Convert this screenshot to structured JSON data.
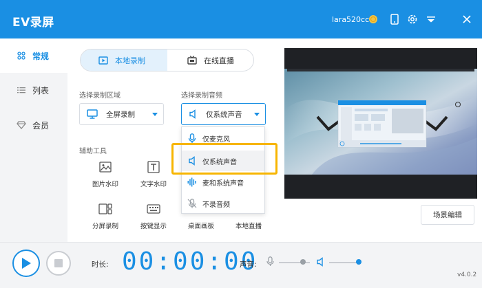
{
  "window": {
    "title": "EV录屏",
    "username": "lara520cc"
  },
  "sidebar": {
    "items": [
      {
        "label": "常规"
      },
      {
        "label": "列表"
      },
      {
        "label": "会员"
      }
    ]
  },
  "mode_tabs": [
    {
      "label": "本地录制"
    },
    {
      "label": "在线直播"
    }
  ],
  "record_area": {
    "label": "选择录制区域",
    "value": "全屏录制"
  },
  "record_audio": {
    "label": "选择录制音频",
    "value": "仅系统声音",
    "options": [
      "仅麦克风",
      "仅系统声音",
      "麦和系统声音",
      "不录音频"
    ]
  },
  "tools": {
    "label": "辅助工具",
    "items": [
      {
        "label": "图片水印"
      },
      {
        "label": "文字水印"
      },
      {
        "label": "分屏录制"
      },
      {
        "label": "按键显示"
      },
      {
        "label": "桌面画板"
      },
      {
        "label": "本地直播"
      }
    ]
  },
  "preview": {
    "scene_button": "场景编辑"
  },
  "bottom": {
    "duration_label": "时长:",
    "timer": "00:00:00",
    "sound_label": "声音:",
    "mic_volume": 0.78,
    "system_volume": 0.95,
    "version": "v4.0.2"
  },
  "colors": {
    "accent": "#1a8fe3",
    "highlight": "#f7b500",
    "sidebar_bg": "#f3f4f6"
  }
}
